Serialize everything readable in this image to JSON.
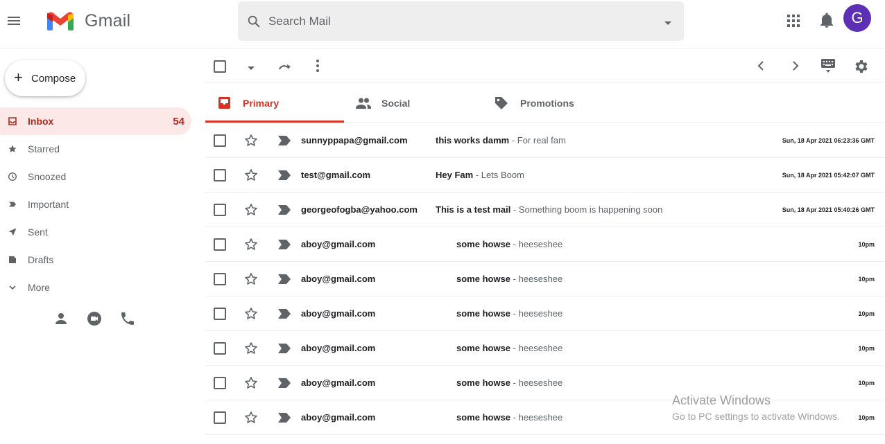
{
  "header": {
    "app_name": "Gmail",
    "search_placeholder": "Search Mail",
    "avatar_letter": "G",
    "avatar_color": "#5c2fb4"
  },
  "sidebar": {
    "compose_label": "Compose",
    "items": [
      {
        "label": "Inbox",
        "count": "54",
        "icon": "inbox-icon",
        "active": true
      },
      {
        "label": "Starred",
        "icon": "star-icon"
      },
      {
        "label": "Snoozed",
        "icon": "clock-icon"
      },
      {
        "label": "Important",
        "icon": "label-important-icon"
      },
      {
        "label": "Sent",
        "icon": "send-icon"
      },
      {
        "label": "Drafts",
        "icon": "draft-icon"
      },
      {
        "label": "More",
        "icon": "chevron-down-icon"
      }
    ],
    "footer_icons": [
      "person-icon",
      "video-icon",
      "phone-icon"
    ]
  },
  "tabs": [
    {
      "label": "Primary",
      "icon": "inbox-icon",
      "active": true
    },
    {
      "label": "Social",
      "icon": "people-icon"
    },
    {
      "label": "Promotions",
      "icon": "tag-icon"
    }
  ],
  "emails": [
    {
      "sender": "sunnyppapa@gmail.com",
      "subject": "this works damm",
      "snippet": " - For real fam",
      "time": "Sun, 18 Apr 2021 06:23:36 GMT"
    },
    {
      "sender": "test@gmail.com",
      "subject": "Hey Fam",
      "snippet": " - Lets Boom",
      "time": "Sun, 18 Apr 2021 05:42:07 GMT"
    },
    {
      "sender": "georgeofogba@yahoo.com",
      "subject": "This is a test mail",
      "snippet": " - Something boom is happening soon",
      "time": "Sun, 18 Apr 2021 05:40:26 GMT"
    },
    {
      "sender": "aboy@gmail.com",
      "subject": "some howse",
      "snippet": " - heeseshee",
      "time": "10pm"
    },
    {
      "sender": "aboy@gmail.com",
      "subject": "some howse",
      "snippet": " - heeseshee",
      "time": "10pm"
    },
    {
      "sender": "aboy@gmail.com",
      "subject": "some howse",
      "snippet": " - heeseshee",
      "time": "10pm"
    },
    {
      "sender": "aboy@gmail.com",
      "subject": "some howse",
      "snippet": " - heeseshee",
      "time": "10pm"
    },
    {
      "sender": "aboy@gmail.com",
      "subject": "some howse",
      "snippet": " - heeseshee",
      "time": "10pm"
    },
    {
      "sender": "aboy@gmail.com",
      "subject": "some howse",
      "snippet": " - heeseshee",
      "time": "10pm"
    }
  ],
  "watermark": {
    "line1": "Activate Windows",
    "line2": "Go to PC settings to activate Windows."
  },
  "colors": {
    "accent": "#d93025",
    "active_nav_bg": "#fce8e6",
    "active_nav_text": "#b3261e"
  }
}
